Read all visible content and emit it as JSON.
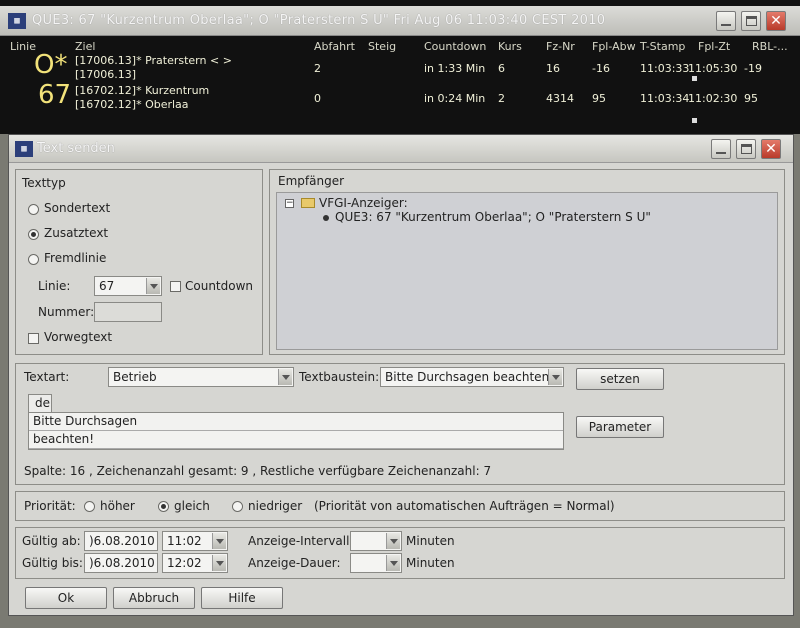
{
  "top_window": {
    "icon_text": "▦",
    "title": "QUE3: 67 \"Kurzentrum Oberlaa\"; O \"Praterstern S U\" Fri Aug 06 11:03:40 CEST 2010",
    "headers": {
      "linie": "Linie",
      "ziel": "Ziel",
      "abfahrt": "Abfahrt",
      "steig": "Steig",
      "countdown": "Countdown",
      "kurs": "Kurs",
      "fz_nr": "Fz-Nr",
      "fpl_abw": "Fpl-Abw",
      "t_stamp": "T-Stamp",
      "fpl_zt": "Fpl-Zt",
      "rbl": "RBL-..."
    },
    "rows": [
      {
        "linie": "O*",
        "ziel_1": "[17006.13]* Praterstern < >",
        "ziel_2": "[17006.13]",
        "abfahrt": "2",
        "countdown": "in 1:33 Min",
        "kurs": "6",
        "fz_nr": "16",
        "fpl_abw": "-16",
        "t_stamp": "11:03:33",
        "fpl_zt": "11:05:30",
        "rbl": "-19"
      },
      {
        "linie": "67",
        "ziel_1": "[16702.12]* Kurzentrum",
        "ziel_2": "[16702.12]* Oberlaa",
        "abfahrt": "0",
        "countdown": "in 0:24 Min",
        "kurs": "2",
        "fz_nr": "4314",
        "fpl_abw": "95",
        "t_stamp": "11:03:34",
        "fpl_zt": "11:02:30",
        "rbl": "95"
      }
    ]
  },
  "dialog": {
    "title": "Text senden",
    "texttyp": {
      "label": "Texttyp",
      "options": [
        "Sondertext",
        "Zusatztext",
        "Fremdlinie"
      ],
      "selected": "Zusatztext",
      "linie_label": "Linie:",
      "linie_value": "67",
      "countdown_label": "Countdown",
      "nummer_label": "Nummer:",
      "nummer_value": "",
      "vorwegtext_label": "Vorwegtext"
    },
    "empfaenger": {
      "label": "Empfänger",
      "expander": "−",
      "root": "VFGI-Anzeiger:",
      "child": "QUE3: 67 \"Kurzentrum Oberlaa\"; O \"Praterstern S U\""
    },
    "text": {
      "textart_label": "Textart:",
      "textart_value": "Betrieb",
      "textbaustein_label": "Textbaustein:",
      "textbaustein_value": "Bitte Durchsagen beachten!",
      "setzen_label": "setzen",
      "tab_label": "de",
      "lines": [
        "Bitte Durchsagen",
        "beachten!"
      ],
      "parameter_label": "Parameter",
      "status": "Spalte: 16 , Zeichenanzahl gesamt: 9 , Restliche verfügbare Zeichenanzahl: 7"
    },
    "prioritaet": {
      "label": "Priorität:",
      "options": [
        "höher",
        "gleich",
        "niedriger"
      ],
      "selected": "gleich",
      "note": "(Priorität von automatischen Aufträgen = Normal)"
    },
    "validity": {
      "gueltig_ab_label": "Gültig ab:",
      "gueltig_ab_date": ")6.08.2010",
      "gueltig_ab_time": "11:02",
      "gueltig_bis_label": "Gültig bis:",
      "gueltig_bis_date": ")6.08.2010",
      "gueltig_bis_time": "12:02",
      "intervall_label": "Anzeige-Intervall:",
      "intervall_value": "",
      "dauer_label": "Anzeige-Dauer:",
      "dauer_value": "",
      "minuten_label": "Minuten"
    },
    "buttons": {
      "ok": "Ok",
      "abbruch": "Abbruch",
      "hilfe": "Hilfe"
    }
  }
}
